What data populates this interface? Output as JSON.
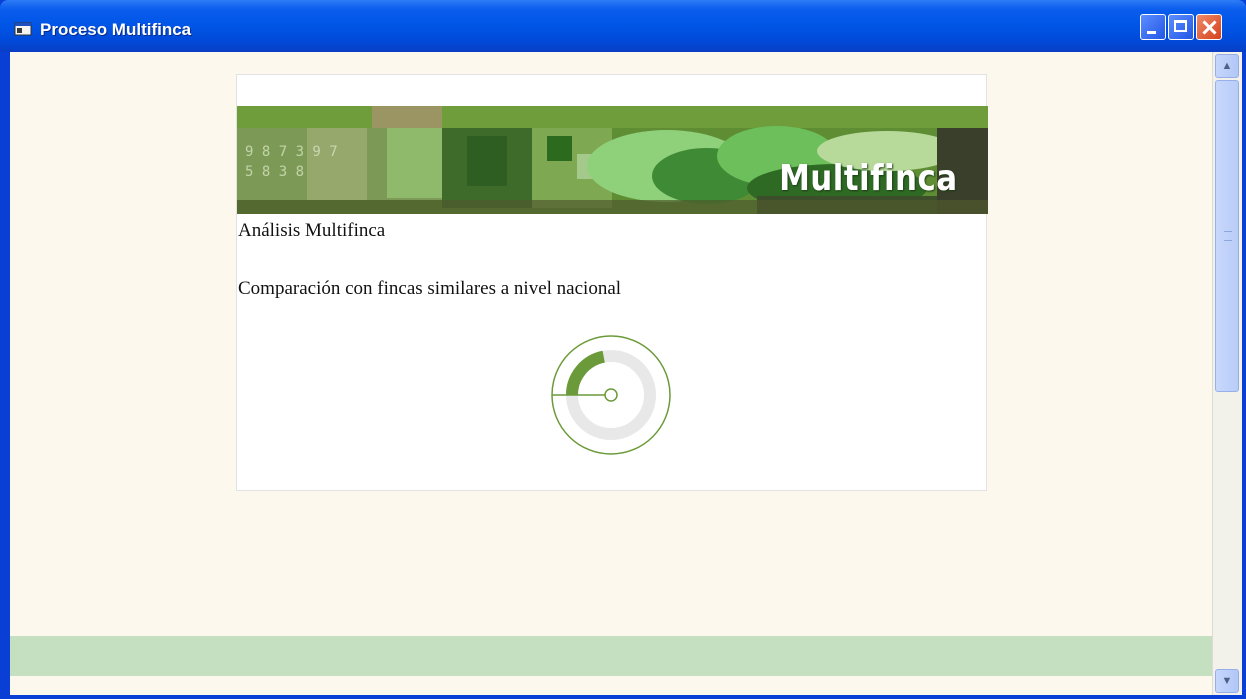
{
  "window": {
    "title": "Proceso Multifinca",
    "app_icon": "window-app-icon",
    "controls": {
      "minimize_icon": "minimize-icon",
      "maximize_icon": "maximize-icon",
      "close_icon": "close-icon"
    }
  },
  "banner": {
    "title": "Multifinca"
  },
  "content": {
    "heading": "Análisis Multifinca",
    "subheading": "Comparación con fincas similares a nivel nacional"
  },
  "gauge": {
    "fill_fraction": 0.22,
    "accent_color": "#6b9a3a",
    "track_color": "#e8e8e8"
  },
  "colors": {
    "client_background": "#fdf8ee",
    "footer_band": "#c5dfc1",
    "titlebar": "#0055e6"
  },
  "scrollbar": {
    "up_icon": "scroll-up-arrow-icon",
    "down_icon": "scroll-down-arrow-icon"
  }
}
